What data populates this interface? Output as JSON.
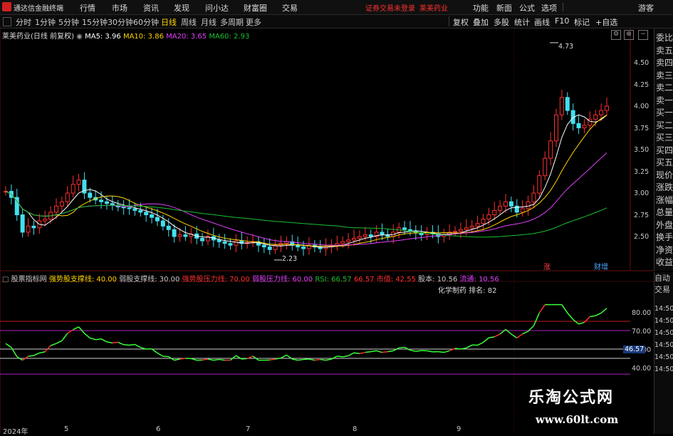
{
  "app": {
    "name": "通达信金融终端"
  },
  "menu": [
    "行情",
    "市场",
    "资讯",
    "发现",
    "问小达",
    "财富圈",
    "交易"
  ],
  "notice": {
    "login": "证券交易未登录",
    "stock": "莱美药业"
  },
  "top_right": [
    "功能",
    "新面",
    "公式",
    "选项",
    "游客"
  ],
  "periods": [
    "分时",
    "1分钟",
    "5分钟",
    "15分钟",
    "30分钟",
    "60分钟",
    "日线",
    "周线",
    "月线",
    "多周期",
    "更多"
  ],
  "active_period": "日线",
  "right_tools": [
    "复权",
    "叠加",
    "多股",
    "统计",
    "画线",
    "F10",
    "标记",
    "+自选"
  ],
  "stock_title": "莱美药业(日线 前复权)",
  "ma": {
    "ma5": "MA5: 3.96",
    "ma10": "MA10: 3.86",
    "ma20": "MA20: 3.65",
    "ma60": "MA60: 2.93",
    "color5": "#ffffff",
    "color10": "#ffd400",
    "color20": "#e040fb",
    "color60": "#19c030"
  },
  "price_axis": [
    "4.50",
    "4.25",
    "4.00",
    "3.75",
    "3.50",
    "3.25",
    "3.00",
    "2.75",
    "2.50"
  ],
  "high_label": "4.73",
  "low_label": "2.23",
  "event_labels": {
    "zhang": "涨",
    "caizeng": "财增"
  },
  "indicator": {
    "name": "股票指标网",
    "items": [
      {
        "text": "强势股支撑线: 40.00",
        "color": "#ffd400"
      },
      {
        "text": "弱股支撑线: 30.00",
        "color": "#c8c8c8"
      },
      {
        "text": "强势股压力线: 70.00",
        "color": "#ff3030"
      },
      {
        "text": "弱股压力线: 60.00",
        "color": "#e040fb"
      },
      {
        "text": "RSI: 66.57",
        "color": "#19c030"
      },
      {
        "text": "66.57",
        "color": "#ff3030"
      },
      {
        "text": "市值: 42.55",
        "color": "#ff3030"
      },
      {
        "text": "股本: 10.56",
        "color": "#c8c8c8"
      },
      {
        "text": "流通: 10.56",
        "color": "#e040fb"
      }
    ],
    "sector": "化学制药 排名: 82",
    "axis": [
      "80.00",
      "70.00",
      "60.00",
      "40.00"
    ],
    "current": "46.57"
  },
  "time_axis": [
    "14:50",
    "14:50",
    "14:50",
    "14:50",
    "14:50",
    "14:50"
  ],
  "dates": [
    "2024年",
    "5",
    "6",
    "7",
    "8",
    "9"
  ],
  "side_quote": [
    "委比",
    "卖五",
    "卖四",
    "卖三",
    "卖二",
    "卖一",
    "买一",
    "买二",
    "买三",
    "买四",
    "买五",
    "现价",
    "涨跌",
    "涨幅",
    "总量",
    "外盘",
    "换手",
    "净资",
    "收益"
  ],
  "side_quote2": [
    "自动",
    "交易"
  ],
  "watermark": {
    "cn": "乐淘公式网",
    "url": "www.60lt.com"
  }
}
